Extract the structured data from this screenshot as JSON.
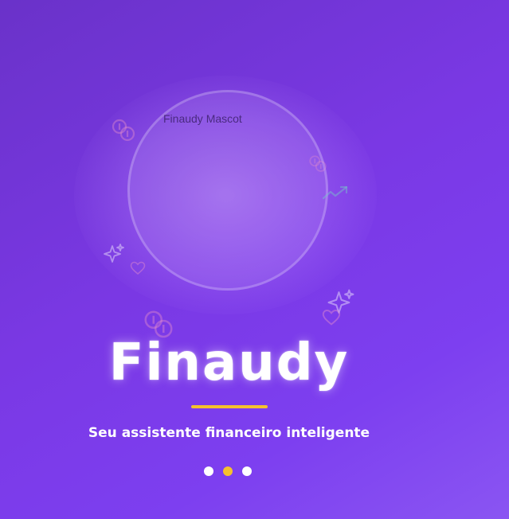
{
  "mascot": {
    "alt_text": "Finaudy Mascot"
  },
  "brand": {
    "title": "Finaudy",
    "tagline": "Seu assistente financeiro inteligente"
  },
  "pagination": {
    "count": 3,
    "active_index": 1
  },
  "decorations": [
    "coins-icon",
    "coins-icon",
    "coins-icon",
    "trend-up-icon",
    "sparkles-icon",
    "sparkles-icon",
    "heart-icon",
    "heart-icon"
  ],
  "colors": {
    "background_start": "#6a32c9",
    "background_end": "#8a55f2",
    "accent": "#f5c12e",
    "text": "#ffffff"
  }
}
